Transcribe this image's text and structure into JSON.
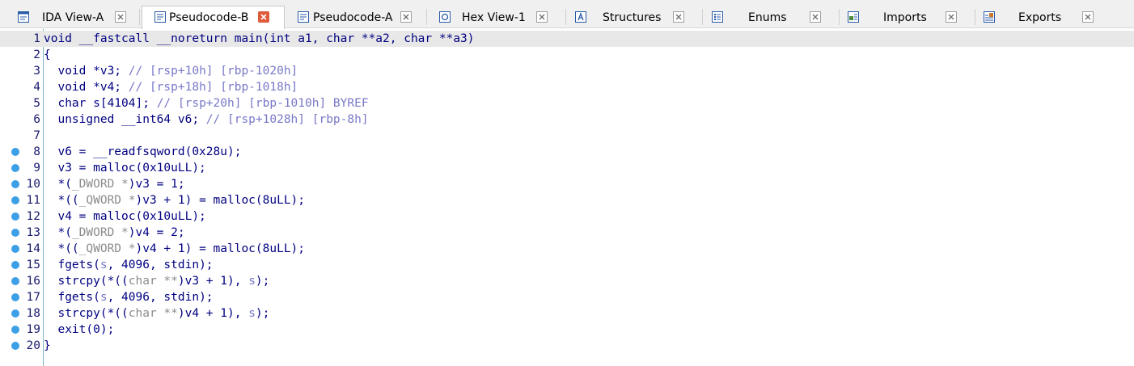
{
  "tabs": [
    {
      "label": "IDA View-A",
      "icon": "ida-view-icon",
      "active": false
    },
    {
      "label": "Pseudocode-B",
      "icon": "pseudocode-icon",
      "active": true
    },
    {
      "label": "Pseudocode-A",
      "icon": "pseudocode-icon",
      "active": false
    },
    {
      "label": "Hex View-1",
      "icon": "hex-view-icon",
      "active": false
    },
    {
      "label": "Structures",
      "icon": "structures-icon",
      "active": false
    },
    {
      "label": "Enums",
      "icon": "enums-icon",
      "active": false
    },
    {
      "label": "Imports",
      "icon": "imports-icon",
      "active": false
    },
    {
      "label": "Exports",
      "icon": "exports-icon",
      "active": false
    }
  ],
  "colors": {
    "active_close": "#e05a3a",
    "breakpoint": "#3d9fe6",
    "current_line": "#e8e8e8",
    "code_text": "#000080",
    "comment_text": "#7878c8"
  },
  "code": {
    "lines": [
      {
        "num": "1",
        "bp": false,
        "current": true,
        "tokens": [
          {
            "t": "void __fastcall __noreturn main(int a1, char **a2, char **a3)",
            "c": "kw"
          }
        ]
      },
      {
        "num": "2",
        "bp": false,
        "tokens": [
          {
            "t": "{",
            "c": "kw"
          }
        ]
      },
      {
        "num": "3",
        "bp": false,
        "tokens": [
          {
            "t": "  void *v3; ",
            "c": "kw"
          },
          {
            "t": "// [rsp+10h] [rbp-1020h]",
            "c": "cmt"
          }
        ]
      },
      {
        "num": "4",
        "bp": false,
        "tokens": [
          {
            "t": "  void *v4; ",
            "c": "kw"
          },
          {
            "t": "// [rsp+18h] [rbp-1018h]",
            "c": "cmt"
          }
        ]
      },
      {
        "num": "5",
        "bp": false,
        "tokens": [
          {
            "t": "  char s[4104]; ",
            "c": "kw"
          },
          {
            "t": "// [rsp+20h] [rbp-1010h] BYREF",
            "c": "cmt"
          }
        ]
      },
      {
        "num": "6",
        "bp": false,
        "tokens": [
          {
            "t": "  unsigned __int64 v6; ",
            "c": "kw"
          },
          {
            "t": "// [rsp+1028h] [rbp-8h]",
            "c": "cmt"
          }
        ]
      },
      {
        "num": "7",
        "bp": false,
        "tokens": [
          {
            "t": "",
            "c": "kw"
          }
        ]
      },
      {
        "num": "8",
        "bp": true,
        "tokens": [
          {
            "t": "  v6 = __readfsqword(0x28u);",
            "c": "kw"
          }
        ]
      },
      {
        "num": "9",
        "bp": true,
        "tokens": [
          {
            "t": "  v3 = malloc(0x10uLL);",
            "c": "kw"
          }
        ]
      },
      {
        "num": "10",
        "bp": true,
        "tokens": [
          {
            "t": "  *(",
            "c": "kw"
          },
          {
            "t": "_DWORD *",
            "c": "gray"
          },
          {
            "t": ")v3 = 1;",
            "c": "kw"
          }
        ]
      },
      {
        "num": "11",
        "bp": true,
        "tokens": [
          {
            "t": "  *((",
            "c": "kw"
          },
          {
            "t": "_QWORD *",
            "c": "gray"
          },
          {
            "t": ")v3 + 1) = malloc(8uLL);",
            "c": "kw"
          }
        ]
      },
      {
        "num": "12",
        "bp": true,
        "tokens": [
          {
            "t": "  v4 = malloc(0x10uLL);",
            "c": "kw"
          }
        ]
      },
      {
        "num": "13",
        "bp": true,
        "tokens": [
          {
            "t": "  *(",
            "c": "kw"
          },
          {
            "t": "_DWORD *",
            "c": "gray"
          },
          {
            "t": ")v4 = 2;",
            "c": "kw"
          }
        ]
      },
      {
        "num": "14",
        "bp": true,
        "tokens": [
          {
            "t": "  *((",
            "c": "kw"
          },
          {
            "t": "_QWORD *",
            "c": "gray"
          },
          {
            "t": ")v4 + 1) = malloc(8uLL);",
            "c": "kw"
          }
        ]
      },
      {
        "num": "15",
        "bp": true,
        "tokens": [
          {
            "t": "  fgets(",
            "c": "kw"
          },
          {
            "t": "s",
            "c": "cmt"
          },
          {
            "t": ", 4096, stdin);",
            "c": "kw"
          }
        ]
      },
      {
        "num": "16",
        "bp": true,
        "tokens": [
          {
            "t": "  strcpy(*((",
            "c": "kw"
          },
          {
            "t": "char **",
            "c": "gray"
          },
          {
            "t": ")v3 + 1), ",
            "c": "kw"
          },
          {
            "t": "s",
            "c": "cmt"
          },
          {
            "t": ");",
            "c": "kw"
          }
        ]
      },
      {
        "num": "17",
        "bp": true,
        "tokens": [
          {
            "t": "  fgets(",
            "c": "kw"
          },
          {
            "t": "s",
            "c": "cmt"
          },
          {
            "t": ", 4096, stdin);",
            "c": "kw"
          }
        ]
      },
      {
        "num": "18",
        "bp": true,
        "tokens": [
          {
            "t": "  strcpy(*((",
            "c": "kw"
          },
          {
            "t": "char **",
            "c": "gray"
          },
          {
            "t": ")v4 + 1), ",
            "c": "kw"
          },
          {
            "t": "s",
            "c": "cmt"
          },
          {
            "t": ");",
            "c": "kw"
          }
        ]
      },
      {
        "num": "19",
        "bp": true,
        "tokens": [
          {
            "t": "  exit(0);",
            "c": "kw"
          }
        ]
      },
      {
        "num": "20",
        "bp": true,
        "tokens": [
          {
            "t": "}",
            "c": "kw"
          }
        ]
      }
    ]
  }
}
